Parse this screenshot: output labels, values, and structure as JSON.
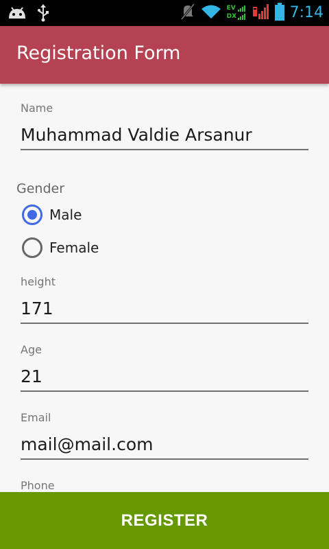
{
  "status_bar": {
    "time": "7:14",
    "ev_top": "EV",
    "ev_bottom": "DX",
    "icons": [
      "android-icon",
      "usb-icon",
      "mute-icon",
      "wifi-icon",
      "ev-signal-icon",
      "signal-icon",
      "battery-icon"
    ],
    "time_color": "#33b5e5"
  },
  "app_bar": {
    "title": "Registration Form",
    "color": "#b44253"
  },
  "form": {
    "name": {
      "label": "Name",
      "value": "Muhammad Valdie Arsanur"
    },
    "gender": {
      "label": "Gender",
      "options": [
        {
          "label": "Male",
          "checked": true
        },
        {
          "label": "Female",
          "checked": false
        }
      ]
    },
    "height": {
      "label": "height",
      "value": "171"
    },
    "age": {
      "label": "Age",
      "value": "21"
    },
    "email": {
      "label": "Email",
      "value": "mail@mail.com"
    },
    "phone": {
      "label": "Phone",
      "value": ""
    }
  },
  "register_button": {
    "label": "REGISTER",
    "color": "#669900"
  }
}
